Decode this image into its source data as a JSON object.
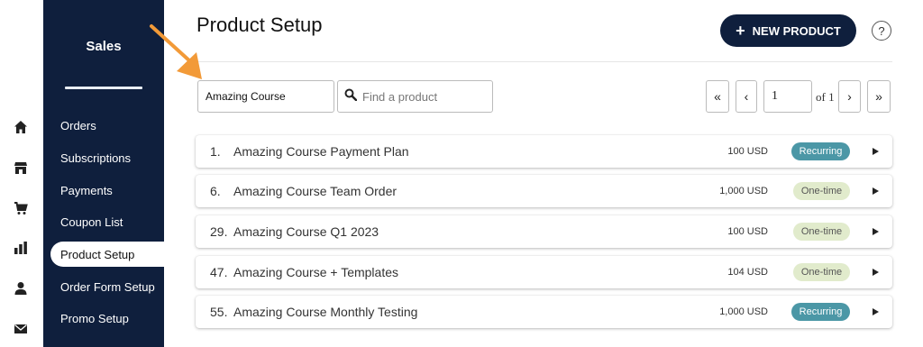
{
  "sidebar": {
    "title": "Sales",
    "items": [
      {
        "label": "Orders",
        "active": false
      },
      {
        "label": "Subscriptions",
        "active": false
      },
      {
        "label": "Payments",
        "active": false
      },
      {
        "label": "Coupon List",
        "active": false
      },
      {
        "label": "Product Setup",
        "active": true
      },
      {
        "label": "Order Form Setup",
        "active": false
      },
      {
        "label": "Promo Setup",
        "active": false
      }
    ]
  },
  "iconbar": [
    "home-icon",
    "store-icon",
    "cart-icon",
    "bar-chart-icon",
    "user-icon",
    "mail-icon"
  ],
  "header": {
    "title": "Product Setup",
    "new_button_label": "NEW PRODUCT",
    "help_label": "?"
  },
  "filters": {
    "filter_value": "Amazing Course",
    "search_placeholder": "Find a product"
  },
  "pagination": {
    "first": "«",
    "prev": "‹",
    "page": "1",
    "of_label": "of 1",
    "next": "›",
    "last": "»"
  },
  "products": [
    {
      "number": "1.",
      "name": "Amazing Course Payment Plan",
      "price": "100 USD",
      "type": "Recurring"
    },
    {
      "number": "6.",
      "name": "Amazing Course Team Order",
      "price": "1,000 USD",
      "type": "One-time"
    },
    {
      "number": "29.",
      "name": "Amazing Course Q1 2023",
      "price": "100 USD",
      "type": "One-time"
    },
    {
      "number": "47.",
      "name": "Amazing Course + Templates",
      "price": "104 USD",
      "type": "One-time"
    },
    {
      "number": "55.",
      "name": "Amazing Course Monthly Testing",
      "price": "1,000 USD",
      "type": "Recurring"
    }
  ],
  "colors": {
    "sidebar_bg": "#0f1f3d",
    "recurring_badge": "#4b97a6",
    "onetime_badge": "#e1ebcc",
    "annotation_arrow": "#f29a38"
  }
}
